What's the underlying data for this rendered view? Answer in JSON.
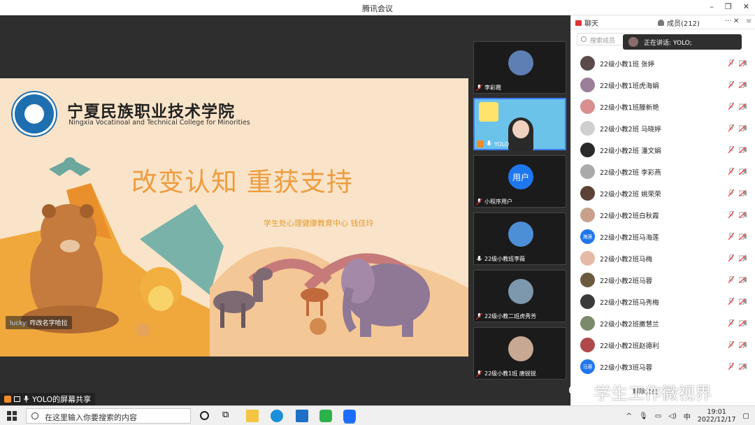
{
  "app": {
    "title": "腾讯会议"
  },
  "slide": {
    "college_cn": "宁夏民族职业技术学院",
    "college_en": "Ningxia Vocatinoal and Technical College for Minorities",
    "title": "改变认知 重获支持",
    "subtitle": "学生处心理健康教育中心    钱佳玲",
    "chip_user": "lucky:",
    "chip_text": "咋改名字哈拉"
  },
  "share_label": "YOLO的屏幕共享",
  "video_tiles": [
    {
      "name": "李彩霞"
    },
    {
      "name": "YOLO"
    },
    {
      "name": "小程序用户",
      "avatar_text": "用户"
    },
    {
      "name": "22级小教班李薇"
    },
    {
      "name": "22级小教二班虎秀芳"
    },
    {
      "name": "22级小教1班 唐锐锐"
    }
  ],
  "panel": {
    "tab_chat": "聊天",
    "tab_members": "成员(212)",
    "search_placeholder": "搜索成员",
    "speaking": "正在讲话: YOLO;",
    "footer": "解除全员",
    "members": [
      {
        "name": "22级小教1班 张婷"
      },
      {
        "name": "22级小教1班虎海娟"
      },
      {
        "name": "22级小教1班滕新艳"
      },
      {
        "name": "22级小教2班 马晓婷"
      },
      {
        "name": "22级小教2班 潘文娟"
      },
      {
        "name": "22级小教2班 李彩燕"
      },
      {
        "name": "22级小教2班 姚荣荣"
      },
      {
        "name": "22级小教2班白秋霞"
      },
      {
        "name": "22级小教2班马海莲",
        "avatar_text": "海莲"
      },
      {
        "name": "22级小教2班马梅"
      },
      {
        "name": "22级小教2班马蓉"
      },
      {
        "name": "22级小教2班马秀梅"
      },
      {
        "name": "22级小教2班撒慧兰"
      },
      {
        "name": "22级小教2班赵德利"
      },
      {
        "name": "22级小教3班马蓉",
        "avatar_text": "马蓉"
      }
    ]
  },
  "watermark": "学生工作微视界",
  "taskbar": {
    "search_placeholder": "在这里输入你要搜索的内容",
    "ime": "中",
    "time": "19:01",
    "date": "2022/12/17"
  },
  "colors": {
    "accent": "#1f77ee",
    "title_orange": "#ee9d40",
    "slide_bg": "#fae4c9"
  }
}
